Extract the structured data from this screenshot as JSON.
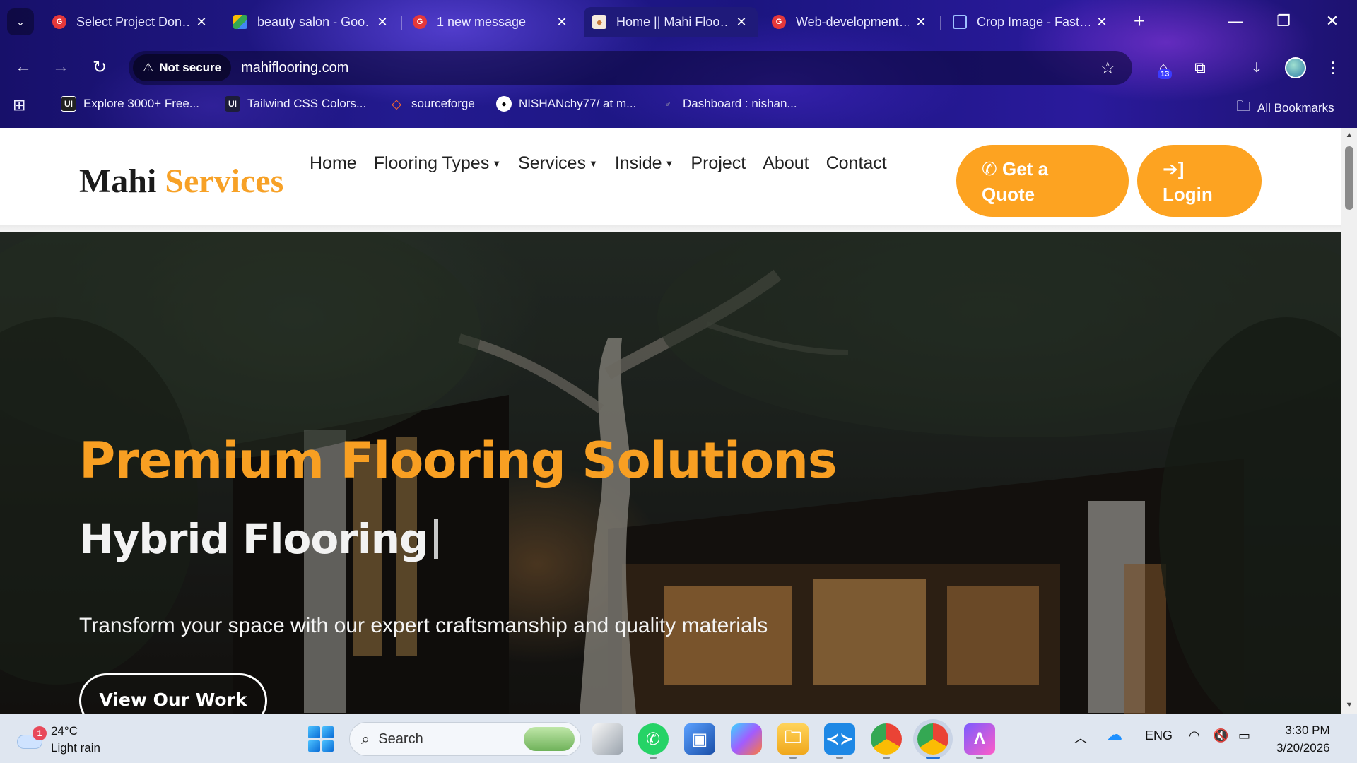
{
  "tabs": [
    {
      "title": "Select Project Don…",
      "favicon_color": "#e5383b"
    },
    {
      "title": "beauty salon - Goo…",
      "favicon_color": "#34a853"
    },
    {
      "title": "1 new message",
      "favicon_color": "#e5383b"
    },
    {
      "title": "Home || Mahi Floo…",
      "favicon_color": "#c97a3a"
    },
    {
      "title": "Web-development…",
      "favicon_color": "#e5383b"
    },
    {
      "title": "Crop Image - Fast…",
      "favicon_color": "#4a7fd6"
    }
  ],
  "omnibox": {
    "security_label": "Not secure",
    "url": "mahiflooring.com"
  },
  "extensions": {
    "badge": "13"
  },
  "bookmarks": [
    {
      "label": "Explore 3000+ Free...",
      "icon_text": "UI"
    },
    {
      "label": "Tailwind CSS Colors...",
      "icon_text": "UI"
    },
    {
      "label": "sourceforge",
      "icon_text": "◇"
    },
    {
      "label": "NISHANchy77/ at m...",
      "icon_text": "●"
    },
    {
      "label": "Dashboard : nishan...",
      "icon_text": "♂"
    }
  ],
  "bookmarks_all": "All Bookmarks",
  "site": {
    "logo_main": "Mahi",
    "logo_accent": "Services",
    "nav": [
      {
        "label": "Home",
        "dropdown": false
      },
      {
        "label": "Flooring Types",
        "dropdown": true
      },
      {
        "label": "Services",
        "dropdown": true
      },
      {
        "label": "Inside",
        "dropdown": true
      },
      {
        "label": "Project",
        "dropdown": false
      },
      {
        "label": "About",
        "dropdown": false
      },
      {
        "label": "Contact",
        "dropdown": false
      }
    ],
    "quote_line1": "Get a",
    "quote_line2": "Quote",
    "login": "Login",
    "accent_color": "#fda321"
  },
  "hero": {
    "title": "Premium Flooring Solutions",
    "subtitle": "Hybrid Flooring",
    "text": "Transform your space with our expert craftsmanship and quality materials",
    "button": "View Our Work"
  },
  "taskbar": {
    "weather_badge": "1",
    "temperature": "24°C",
    "condition": "Light rain",
    "search_placeholder": "Search",
    "language": "ENG",
    "time": "3:30 PM",
    "date": "3/20/2026"
  }
}
